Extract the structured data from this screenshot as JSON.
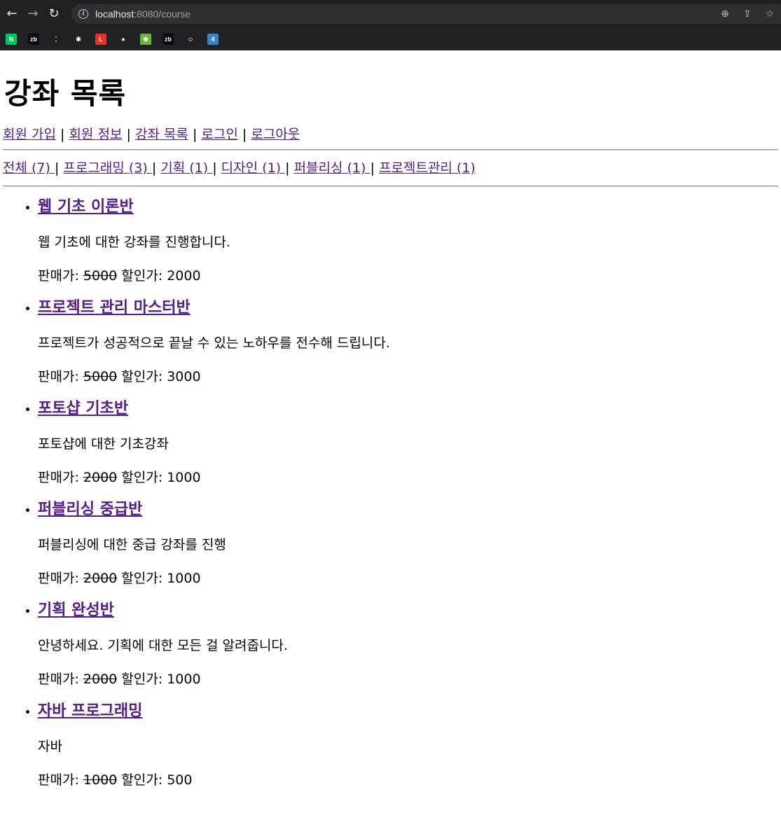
{
  "browser": {
    "url_host": "localhost",
    "url_path": ":8080/course",
    "bookmarks": [
      {
        "name": "naver-bookmark-icon",
        "label": "N",
        "color": "#03c75a"
      },
      {
        "name": "zb-bookmark-icon",
        "label": "zb",
        "color": "#000000"
      },
      {
        "name": "dots-bookmark-icon",
        "label": "⁚",
        "color": "#202124"
      },
      {
        "name": "slack-bookmark-icon",
        "label": "✱",
        "color": "#202124"
      },
      {
        "name": "l-bookmark-icon",
        "label": "L",
        "color": "#e8322c"
      },
      {
        "name": "github-bookmark-icon",
        "label": "●",
        "color": "#202124"
      },
      {
        "name": "spring-bookmark-icon",
        "label": "❀",
        "color": "#6db33f"
      },
      {
        "name": "zb2-bookmark-icon",
        "label": "zb",
        "color": "#000000"
      },
      {
        "name": "person-bookmark-icon",
        "label": "☺",
        "color": "#202124"
      },
      {
        "name": "four-bookmark-icon",
        "label": "4",
        "color": "#3b82c4"
      }
    ]
  },
  "page": {
    "title": "강좌 목록",
    "nav": {
      "signup": "회원 가입",
      "member_info": "회원 정보",
      "course_list": "강좌 목록",
      "login": "로그인",
      "logout": "로그아웃",
      "separator": "|"
    },
    "categories": [
      "전체 (7) ",
      "프로그래밍 (3) ",
      "기획 (1) ",
      "디자인 (1) ",
      "퍼블리싱 (1) ",
      "프로젝트관리 (1)"
    ],
    "price_label": "판매가:",
    "sale_label": "할인가:",
    "courses": [
      {
        "title": "웹 기초 이론반",
        "desc": "웹 기초에 대한 강좌를 진행합니다.",
        "price": "5000",
        "sale": "2000"
      },
      {
        "title": "프로젝트 관리 마스터반",
        "desc": "프로젝트가 성공적으로 끝날 수 있는 노하우를 전수해 드립니다.",
        "price": "5000",
        "sale": "3000"
      },
      {
        "title": "포토샵 기초반",
        "desc": "포토샵에 대한 기초강좌",
        "price": "2000",
        "sale": "1000"
      },
      {
        "title": "퍼블리싱 중급반",
        "desc": "퍼블리싱에 대한 중급 강좌를 진행",
        "price": "2000",
        "sale": "1000"
      },
      {
        "title": "기획 완성반",
        "desc": "안녕하세요. 기획에 대한 모든 걸 알려줍니다.",
        "price": "2000",
        "sale": "1000"
      },
      {
        "title": "자바 프로그래밍",
        "desc": "자바",
        "price": "1000",
        "sale": "500"
      }
    ]
  }
}
